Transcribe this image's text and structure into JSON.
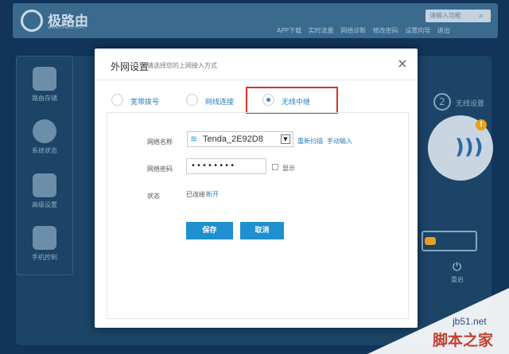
{
  "background": {
    "logo_text": "极路由",
    "logo_sub": "www.hiwifi.com",
    "search_placeholder": "请输入功能",
    "nav": [
      "APP下载",
      "实时流量",
      "网络诊断",
      "修改密码",
      "设置向导",
      "退出"
    ],
    "sidebar": [
      "路由存储",
      "系统状态",
      "高级设置",
      "手机控制"
    ],
    "step_number": "2",
    "step_label": "无线设置",
    "warn_badge": "!",
    "power_label": "重启"
  },
  "modal": {
    "title": "外网设置",
    "subtitle": "请选择您的上网接入方式",
    "close_icon": "×",
    "tabs": [
      {
        "label": "宽带拨号",
        "selected": false
      },
      {
        "label": "网线连接",
        "selected": false
      },
      {
        "label": "无线中继",
        "selected": true
      }
    ],
    "form": {
      "network_name_label": "网络名称",
      "ssid_value": "Tenda_2E92D8",
      "rescan_link": "重新扫描",
      "manual_link": "手动输入",
      "password_label": "网络密码",
      "password_value": "••••••••",
      "show_label": "显示",
      "status_label": "状态",
      "status_value": "已连接",
      "refresh_link": "断开"
    },
    "buttons": {
      "save": "保存",
      "cancel": "取消"
    }
  },
  "watermark": {
    "site": "jb51.net",
    "brand": "脚本之家"
  },
  "colors": {
    "accent": "#1f8fcf",
    "highlight": "#d8352c",
    "link": "#2b7fbf"
  }
}
